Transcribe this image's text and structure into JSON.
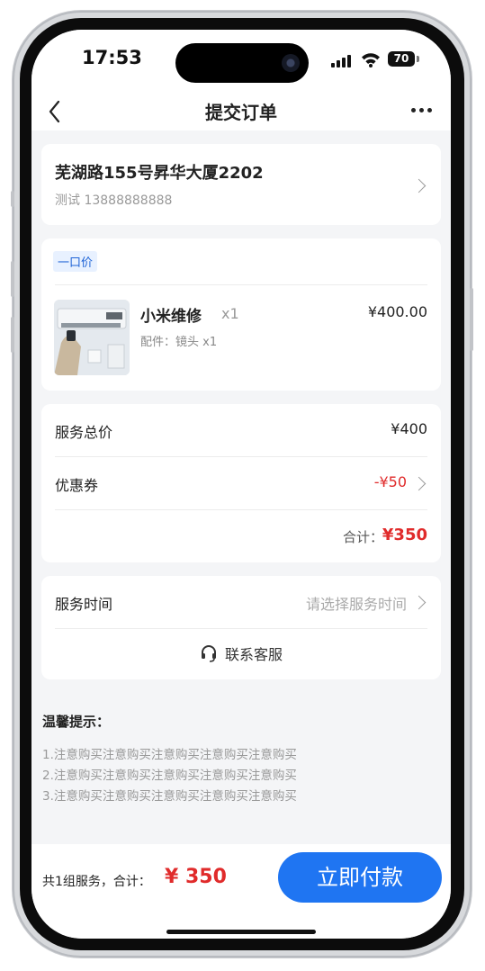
{
  "status_bar": {
    "time": "17:53",
    "battery": "70"
  },
  "nav": {
    "title": "提交订单"
  },
  "address": {
    "line": "芜湖路155号昇华大厦2202",
    "contact": "测试   13888888888"
  },
  "order": {
    "tag": "一口价",
    "product_name": "小米维修",
    "quantity": "x1",
    "price": "¥400.00",
    "parts": "配件：镜头 x1"
  },
  "price_summary": {
    "service_total_label": "服务总价",
    "service_total_value": "¥400",
    "coupon_label": "优惠券",
    "coupon_value": "-¥50",
    "total_label": "合计：",
    "total_value": "¥350"
  },
  "service_time": {
    "label": "服务时间",
    "placeholder": "请选择服务时间"
  },
  "customer_service": {
    "label": "联系客服"
  },
  "tips": {
    "title": "温馨提示：",
    "lines": [
      "1.注意购买注意购买注意购买注意购买注意购买",
      "2.注意购买注意购买注意购买注意购买注意购买",
      "3.注意购买注意购买注意购买注意购买注意购买"
    ]
  },
  "bottom_bar": {
    "summary": "共1组服务，合计：",
    "amount": "¥ 350",
    "pay_label": "立即付款"
  },
  "colors": {
    "accent": "#1f75f2",
    "price_red": "#e02b2b",
    "tag_bg": "#e8f1ff",
    "page_bg": "#f4f5f7"
  }
}
